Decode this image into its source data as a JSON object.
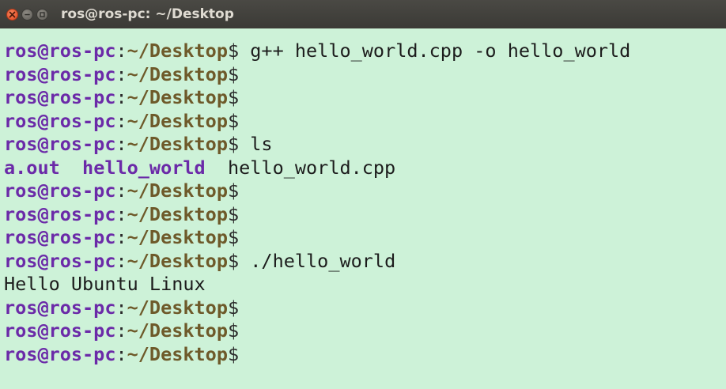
{
  "window": {
    "title": "ros@ros-pc: ~/Desktop"
  },
  "prompt": {
    "user_host": "ros@ros-pc",
    "colon": ":",
    "path": "~/Desktop",
    "dollar": "$"
  },
  "lines": [
    {
      "type": "prompt",
      "command": " g++ hello_world.cpp -o hello_world"
    },
    {
      "type": "prompt",
      "command": ""
    },
    {
      "type": "prompt",
      "command": ""
    },
    {
      "type": "prompt",
      "command": ""
    },
    {
      "type": "prompt",
      "command": " ls"
    },
    {
      "type": "ls",
      "items": [
        "a.out",
        "hello_world",
        "hello_world.cpp"
      ]
    },
    {
      "type": "prompt",
      "command": ""
    },
    {
      "type": "prompt",
      "command": ""
    },
    {
      "type": "prompt",
      "command": ""
    },
    {
      "type": "prompt",
      "command": " ./hello_world"
    },
    {
      "type": "output",
      "text": "Hello Ubuntu Linux"
    },
    {
      "type": "prompt",
      "command": ""
    },
    {
      "type": "prompt",
      "command": ""
    },
    {
      "type": "prompt",
      "command": ""
    }
  ],
  "colors": {
    "background": "#cdf2d8",
    "user_host": "#6b2aa8",
    "path": "#6e5a2a",
    "titlebar": "#3b3a36",
    "close_button": "#e0461e"
  },
  "icons": {
    "close": "close-icon",
    "minimize": "minimize-icon",
    "maximize": "maximize-icon"
  }
}
